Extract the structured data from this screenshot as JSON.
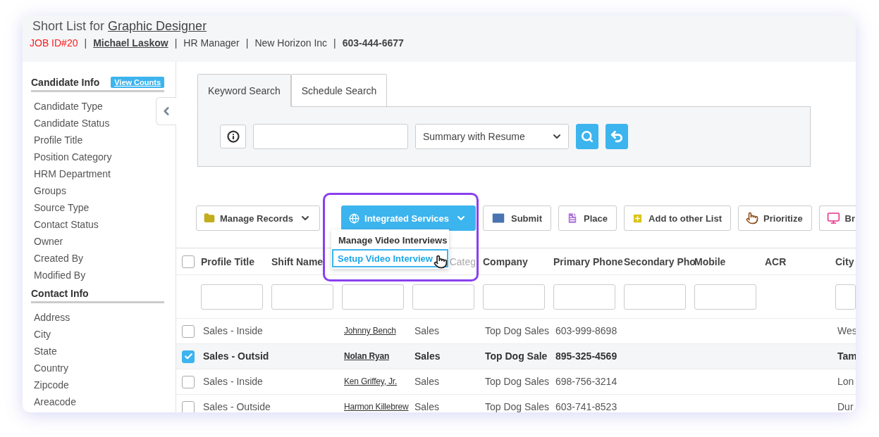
{
  "header": {
    "title_prefix": "Short List for",
    "title_link": "Graphic Designer",
    "job_id": "JOB ID#20",
    "contact_name": "Michael Laskow",
    "role": "HR Manager",
    "company": "New Horizon Inc",
    "phone": "603-444-6677",
    "separator": "|"
  },
  "sidebar": {
    "sections": [
      {
        "title": "Candidate Info",
        "action": "View Counts",
        "items": [
          "Candidate Type",
          "Candidate Status",
          "Profile Title",
          "Position Category",
          "HRM Department",
          "Groups",
          "Source Type",
          "Contact Status",
          "Owner",
          "Created By",
          "Modified By"
        ]
      },
      {
        "title": "Contact Info",
        "items": [
          "Address",
          "City",
          "State",
          "Country",
          "Zipcode",
          "Areacode"
        ]
      }
    ]
  },
  "search": {
    "tabs": [
      {
        "label": "Keyword Search",
        "selected": true
      },
      {
        "label": "Schedule Search",
        "selected": false
      }
    ],
    "view_select": "Summary with Resume"
  },
  "toolbar": {
    "buttons": [
      {
        "label": "Manage Records",
        "kind": "dropdown"
      },
      {
        "label": "Integrated Services",
        "kind": "primary-dropdown"
      },
      {
        "label": "Submit",
        "kind": "plain"
      },
      {
        "label": "Place",
        "kind": "plain"
      },
      {
        "label": "Add to other List",
        "kind": "plain"
      },
      {
        "label": "Prioritize",
        "kind": "plain"
      },
      {
        "label": "Br",
        "kind": "plain"
      }
    ]
  },
  "menu": {
    "items": [
      {
        "label": "Manage Video Interviews",
        "selected": false
      },
      {
        "label": "Setup Video Interview",
        "selected": true
      }
    ]
  },
  "table": {
    "select_all": {
      "checked": false
    },
    "columns": [
      {
        "label": "Profile Title",
        "filter": true
      },
      {
        "label": "Shift Name",
        "filter": true
      },
      {
        "filter": true
      },
      {
        "label": "Categ",
        "kind": "covered",
        "filter": true
      },
      {
        "label": "Company",
        "filter": true
      },
      {
        "label": "Primary Phone",
        "filter": true
      },
      {
        "label": "Secondary Pho",
        "filter": true
      },
      {
        "label": "Mobile",
        "filter": true
      },
      {
        "label": "ACR",
        "filter": false
      },
      {
        "label": "City",
        "filter": true
      }
    ],
    "rows": [
      {
        "selected": false,
        "profile_title": "Sales - Inside",
        "name": "Johnny Bench",
        "category": "Sales",
        "company": "Top Dog Sales",
        "primary_phone": "603-999-8698",
        "city": "Wes"
      },
      {
        "selected": true,
        "profile_title": "Sales - Outsid",
        "name": "Nolan Ryan",
        "category": "Sales",
        "company": "Top Dog Sale",
        "primary_phone": "895-325-4569",
        "city": "Tam"
      },
      {
        "selected": false,
        "profile_title": "Sales - Inside",
        "name": "Ken Griffey, Jr.",
        "category": "Sales",
        "company": "Top Dog Sales",
        "primary_phone": "698-756-3214",
        "city": "Lon"
      },
      {
        "selected": false,
        "profile_title": "Sales - Outside",
        "name": "Harmon Killebrew",
        "category": "Sales",
        "company": "Top Dog Sales",
        "primary_phone": "603-741-8523",
        "city": "Dur"
      }
    ]
  }
}
